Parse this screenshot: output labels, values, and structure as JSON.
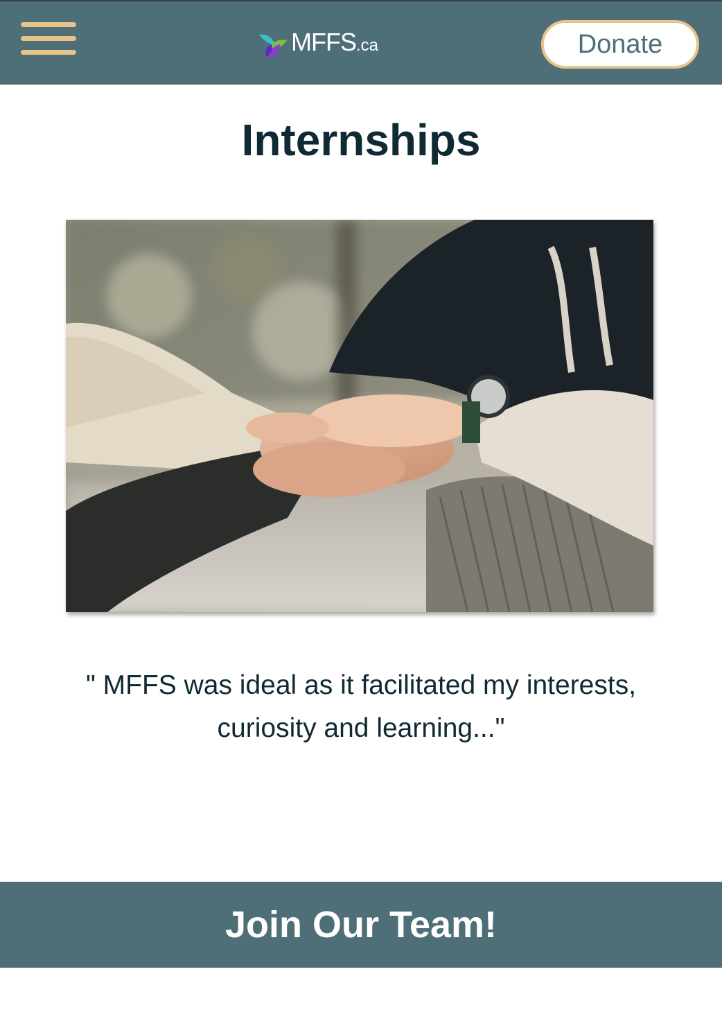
{
  "header": {
    "menu_icon": "hamburger-menu-icon",
    "logo": {
      "name": "MFFS",
      "tld": ".ca",
      "mark_icon": "leaf-logo-icon"
    },
    "donate_label": "Donate"
  },
  "main": {
    "title": "Internships",
    "hero_image_icon": "stacked-hands-photo",
    "quote": "\" MFFS was ideal as it facilitated my interests, curiosity and learning...\""
  },
  "cta": {
    "label": "Join Our Team!"
  },
  "colors": {
    "brand": "#4e6e78",
    "accent": "#e7c48a",
    "heading": "#0f2a33"
  }
}
